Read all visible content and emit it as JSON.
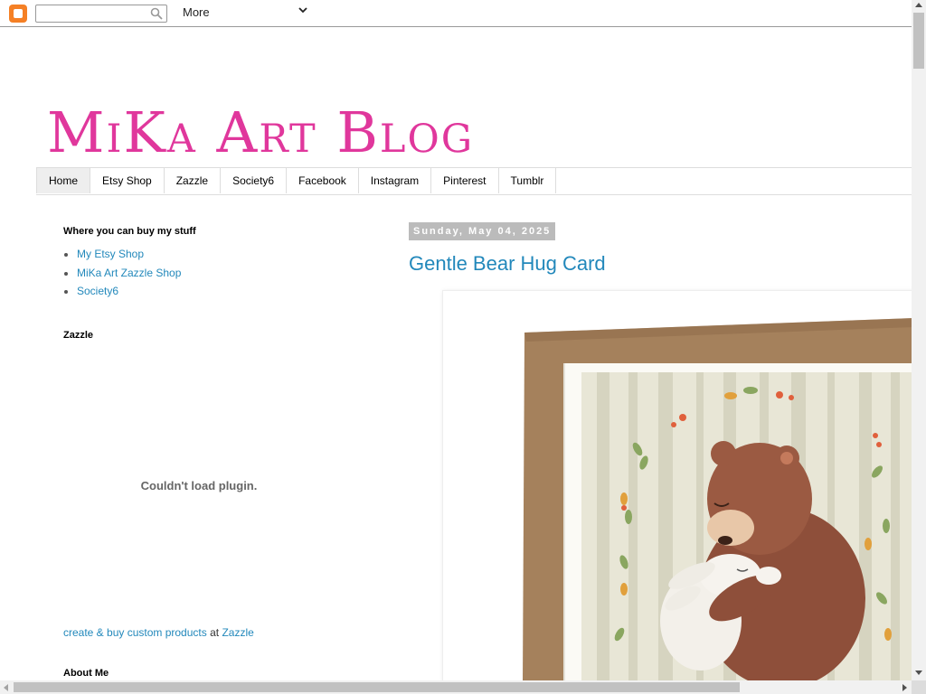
{
  "navbar": {
    "search_placeholder": "",
    "more_label": "More"
  },
  "header": {
    "title": "MiKa Art Blog"
  },
  "tabs": [
    {
      "label": "Home",
      "active": true
    },
    {
      "label": "Etsy Shop"
    },
    {
      "label": "Zazzle"
    },
    {
      "label": "Society6"
    },
    {
      "label": "Facebook"
    },
    {
      "label": "Instagram"
    },
    {
      "label": "Pinterest"
    },
    {
      "label": "Tumblr"
    }
  ],
  "sidebar": {
    "widget1": {
      "title": "Where you can buy my stuff",
      "links": [
        "My Etsy Shop",
        "MiKa Art Zazzle Shop",
        "Society6"
      ]
    },
    "widget2": {
      "title": "Zazzle",
      "plugin_message": "Couldn't load plugin.",
      "footer_link1": "create & buy custom products",
      "footer_at": " at ",
      "footer_link2": "Zazzle"
    },
    "widget3": {
      "title": "About Me"
    }
  },
  "post": {
    "date": "Sunday, May 04, 2025",
    "title": "Gentle Bear Hug Card",
    "image_icon": "bear-hug-card-image"
  },
  "colors": {
    "title_pink": "#e0379c",
    "link_blue": "#2288bb",
    "date_bg": "#bbbbbb",
    "blogger_orange": "#f58025"
  }
}
